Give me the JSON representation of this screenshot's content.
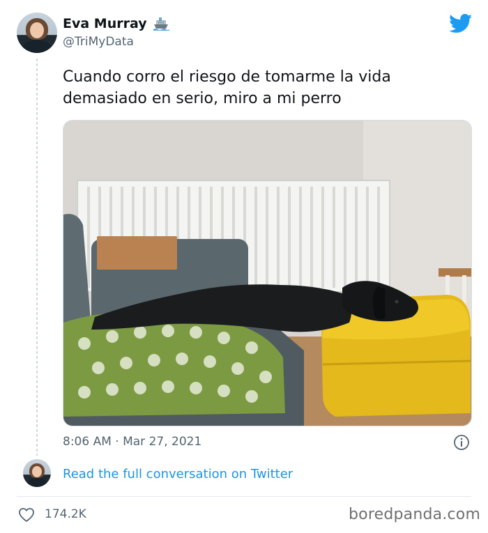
{
  "tweet": {
    "author": {
      "display_name": "Eva Murray",
      "emoji_icon": "ship-icon",
      "handle": "@TriMyData"
    },
    "text": "Cuando corro el riesgo de tomarme la vida demasiado en serio, miro a mi perro",
    "image": {
      "description_icon": "dog-on-sofa-photo"
    },
    "timestamp": "8:06 AM · Mar 27, 2021",
    "read_more_link": "Read the full conversation on Twitter",
    "likes": "174.2K"
  },
  "branding": {
    "platform_icon": "twitter-bird-icon",
    "watermark": "boredpanda.com"
  },
  "colors": {
    "twitter_blue": "#1d9bf0",
    "link_blue": "#1b95e0",
    "secondary_text": "#536471",
    "primary_text": "#0f1419"
  }
}
